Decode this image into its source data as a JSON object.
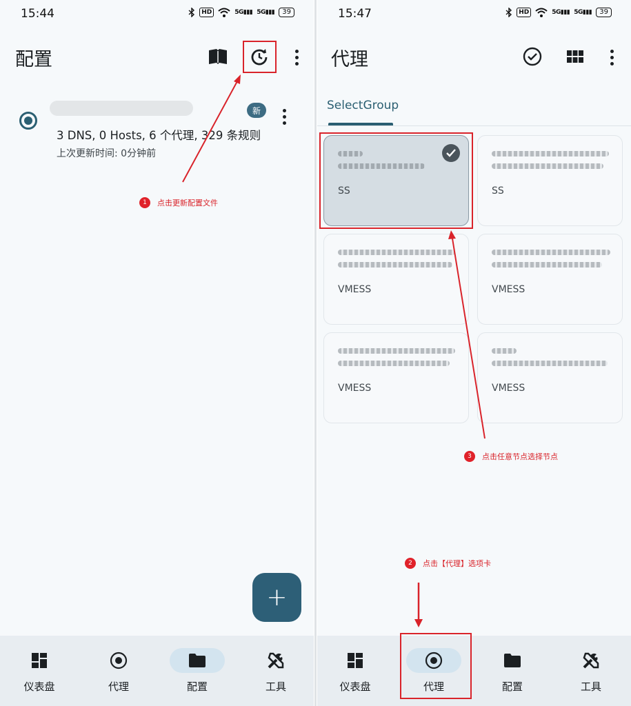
{
  "left": {
    "status_time": "15:44",
    "battery": "39",
    "title": "配置",
    "profile": {
      "badge": "新",
      "summary": "3 DNS, 0 Hosts, 6 个代理, 329 条规则",
      "updated": "上次更新时间: 0分钟前"
    },
    "annotation_1": {
      "num": "1",
      "text": "点击更新配置文件"
    },
    "fab_label": "+",
    "nav": [
      "仪表盘",
      "代理",
      "配置",
      "工具"
    ],
    "active_nav": "配置"
  },
  "right": {
    "status_time": "15:47",
    "battery": "39",
    "title": "代理",
    "tab": "SelectGroup",
    "proxies": [
      {
        "type": "SS",
        "selected": true
      },
      {
        "type": "SS",
        "selected": false
      },
      {
        "type": "VMESS",
        "selected": false
      },
      {
        "type": "VMESS",
        "selected": false
      },
      {
        "type": "VMESS",
        "selected": false
      },
      {
        "type": "VMESS",
        "selected": false
      }
    ],
    "annotation_2": {
      "num": "2",
      "text": "点击【代理】选项卡"
    },
    "annotation_3": {
      "num": "3",
      "text": "点击任意节点选择节点"
    },
    "nav": [
      "仪表盘",
      "代理",
      "配置",
      "工具"
    ],
    "active_nav": "代理"
  },
  "colors": {
    "accent": "#2b5f72",
    "annotation": "#d9232a",
    "fab": "#2d5f77"
  },
  "icons": [
    "bluetooth-icon",
    "wifi-icon",
    "book-icon",
    "refresh-icon",
    "more-vert-icon",
    "check-circle-icon",
    "grid-icon",
    "dashboard-icon",
    "proxy-icon",
    "folder-icon",
    "tools-icon",
    "add-icon"
  ]
}
